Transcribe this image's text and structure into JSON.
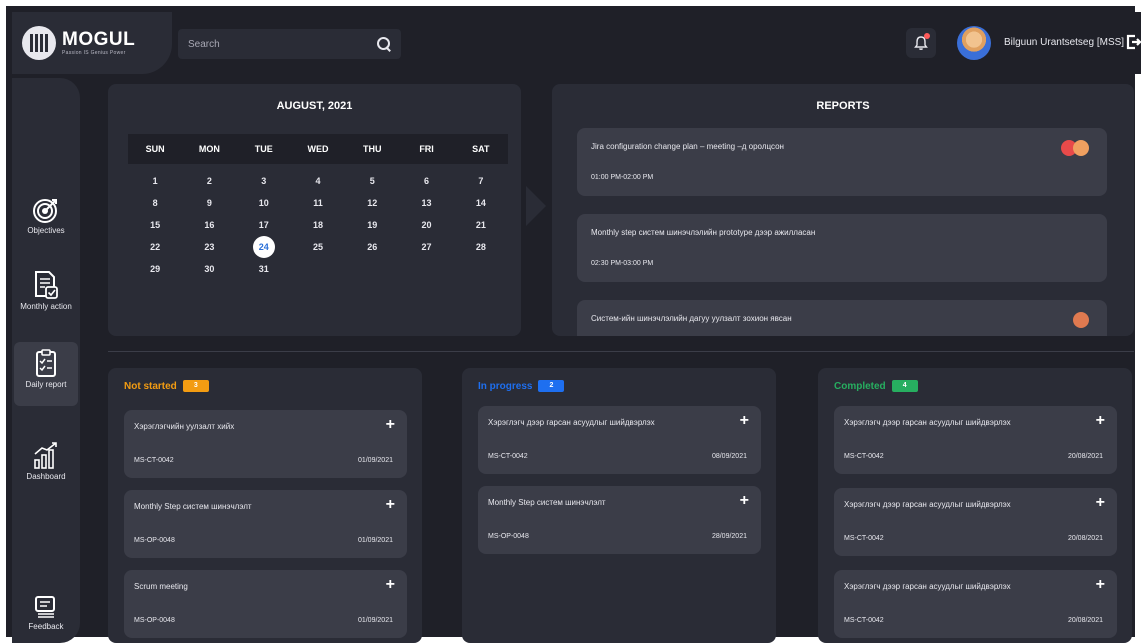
{
  "brand": {
    "name": "MOGUL",
    "tagline": "Passion IS Genius Power"
  },
  "search": {
    "placeholder": "Search"
  },
  "user": {
    "name": "Bilguun Urantsetseg [MSS]"
  },
  "colors": {
    "bg": "#1f2028",
    "panel": "#2a2c36",
    "card": "#3b3d48",
    "not_started": "#f39c12",
    "in_progress": "#1e6ff0",
    "completed": "#27ae60",
    "today": "#2a6fd8"
  },
  "sidebar": {
    "items": [
      {
        "label": "Objectives",
        "icon": "target-icon"
      },
      {
        "label": "Monthly action",
        "icon": "document-icon"
      },
      {
        "label": "Daily report",
        "icon": "clipboard-icon"
      },
      {
        "label": "Dashboard",
        "icon": "bar-chart-icon"
      },
      {
        "label": "Feedback",
        "icon": "feedback-icon"
      }
    ]
  },
  "calendar": {
    "title": "AUGUST, 2021",
    "day_names": [
      "SUN",
      "MON",
      "TUE",
      "WED",
      "THU",
      "FRI",
      "SAT"
    ],
    "weeks": [
      [
        "1",
        "2",
        "3",
        "4",
        "5",
        "6",
        "7"
      ],
      [
        "8",
        "9",
        "10",
        "11",
        "12",
        "13",
        "14"
      ],
      [
        "15",
        "16",
        "17",
        "18",
        "19",
        "20",
        "21"
      ],
      [
        "22",
        "23",
        "24",
        "25",
        "26",
        "27",
        "28"
      ],
      [
        "29",
        "30",
        "31",
        "",
        "",
        "",
        ""
      ]
    ],
    "today": "24"
  },
  "reports": {
    "title": "REPORTS",
    "items": [
      {
        "text": "Jira configuration change plan – meeting –д оролцсон",
        "time": "01:00 PM-02:00 PM"
      },
      {
        "text": "Monthly step систем шинэчлэлийн prototype дээр ажилласан",
        "time": "02:30 PM-03:00 PM"
      },
      {
        "text": "Систем-ийн шинэчлэлийн дагуу уулзалт зохион явсан",
        "time": ""
      }
    ]
  },
  "kanban": {
    "columns": [
      {
        "title": "Not started",
        "count": "3",
        "tasks": [
          {
            "title": "Хэрэглэгчийн уулзалт хийх",
            "code": "MS-CT-0042",
            "date": "01/09/2021"
          },
          {
            "title": "Monthly Step систем шинэчлэлт",
            "code": "MS-OP-0048",
            "date": "01/09/2021"
          },
          {
            "title": "Scrum meeting",
            "code": "MS-OP-0048",
            "date": "01/09/2021"
          }
        ]
      },
      {
        "title": "In progress",
        "count": "2",
        "tasks": [
          {
            "title": "Хэрэглэгч дээр гарсан асуудлыг шийдвэрлэх",
            "code": "MS-CT-0042",
            "date": "08/09/2021"
          },
          {
            "title": "Monthly Step систем шинэчлэлт",
            "code": "MS-OP-0048",
            "date": "28/09/2021"
          }
        ]
      },
      {
        "title": "Completed",
        "count": "4",
        "tasks": [
          {
            "title": "Хэрэглэгч дээр гарсан асуудлыг шийдвэрлэх",
            "code": "MS-CT-0042",
            "date": "20/08/2021"
          },
          {
            "title": "Хэрэглэгч дээр гарсан асуудлыг шийдвэрлэх",
            "code": "MS-CT-0042",
            "date": "20/08/2021"
          },
          {
            "title": "Хэрэглэгч дээр гарсан асуудлыг шийдвэрлэх",
            "code": "MS-CT-0042",
            "date": "20/08/2021"
          }
        ]
      }
    ]
  }
}
